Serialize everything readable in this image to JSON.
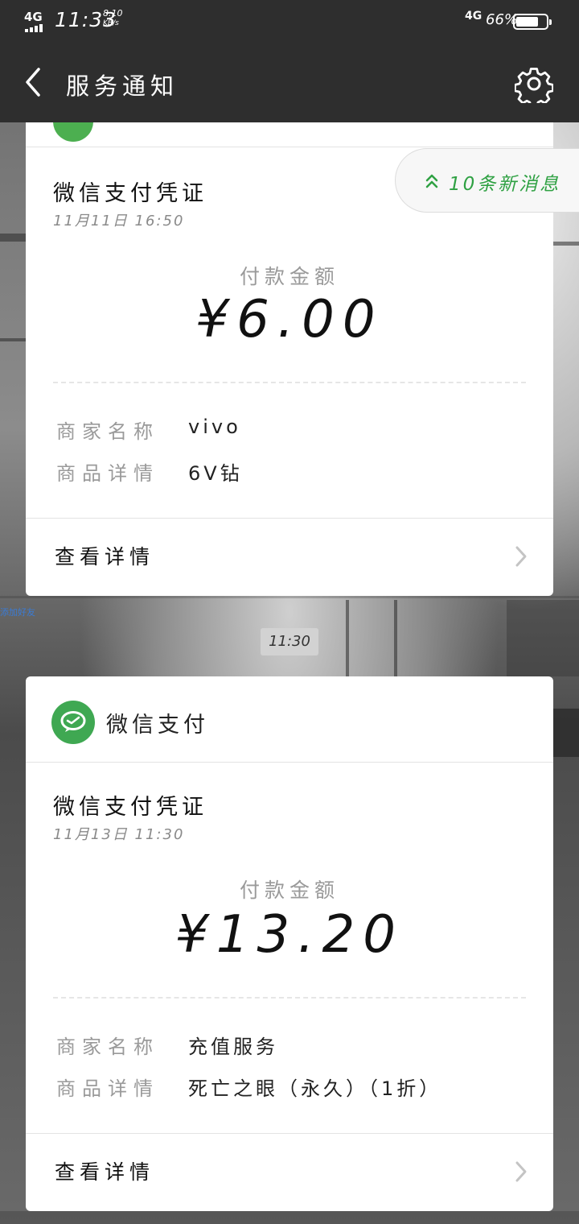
{
  "status_bar": {
    "network": "4G",
    "time": "11:33",
    "speed_value": "8.10",
    "speed_unit": "KB/s",
    "network_right": "4G",
    "battery_percent": "66%"
  },
  "header": {
    "title": "服务通知",
    "back_icon": "chevron-left-icon",
    "settings_icon": "gear-icon"
  },
  "new_messages": {
    "label": "10条新消息",
    "icon": "double-chevron-up-icon"
  },
  "side_tag": "添加好友",
  "card1": {
    "voucher_title": "微信支付凭证",
    "date": "11月11日  16:50",
    "amount_label": "付款金额",
    "amount": "¥6.00",
    "merchant_key": "商家名称",
    "merchant_value": "vivo",
    "item_key": "商品详情",
    "item_value": "6V钻",
    "detail_label": "查看详情"
  },
  "time_divider": "11:30",
  "card2": {
    "sender_name": "微信支付",
    "voucher_title": "微信支付凭证",
    "date": "11月13日  11:30",
    "amount_label": "付款金额",
    "amount": "¥13.20",
    "merchant_key": "商家名称",
    "merchant_value": "充值服务",
    "item_key": "商品详情",
    "item_value": "死亡之眼（永久）（1折）",
    "detail_label": "查看详情"
  },
  "colors": {
    "bar": "#2e2e2e",
    "wechat_green": "#3fa852",
    "accent_green": "#2fa143"
  }
}
